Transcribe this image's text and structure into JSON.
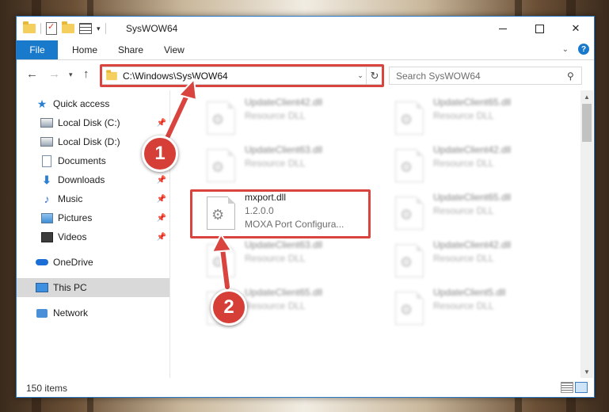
{
  "window": {
    "title": "SysWOW64",
    "accent_color": "#1979ca",
    "annotation_color": "#d9443f"
  },
  "ribbon": {
    "tabs": [
      {
        "label": "File"
      },
      {
        "label": "Home"
      },
      {
        "label": "Share"
      },
      {
        "label": "View"
      }
    ]
  },
  "nav": {
    "address": "C:\\Windows\\SysWOW64",
    "search_placeholder": "Search SysWOW64"
  },
  "sidebar": {
    "items": [
      {
        "label": "Quick access",
        "icon": "star-icon"
      },
      {
        "label": "Local Disk (C:)",
        "icon": "disk-icon"
      },
      {
        "label": "Local Disk (D:)",
        "icon": "disk-icon"
      },
      {
        "label": "Documents",
        "icon": "documents-icon"
      },
      {
        "label": "Downloads",
        "icon": "download-icon"
      },
      {
        "label": "Music",
        "icon": "music-icon"
      },
      {
        "label": "Pictures",
        "icon": "pictures-icon"
      },
      {
        "label": "Videos",
        "icon": "videos-icon"
      },
      {
        "label": "OneDrive",
        "icon": "cloud-icon"
      },
      {
        "label": "This PC",
        "icon": "computer-icon"
      },
      {
        "label": "Network",
        "icon": "network-icon"
      }
    ]
  },
  "files": {
    "left_column": [
      {
        "name": "UpdateClient42.dll",
        "type": "Resource DLL"
      },
      {
        "name": "UpdateClient63.dll",
        "type": "Resource DLL"
      },
      {
        "name": "mxport.dll",
        "version": "1.2.0.0",
        "description": "MOXA Port Configura..."
      },
      {
        "name": "UpdateClient63.dll",
        "type": "Resource DLL"
      },
      {
        "name": "UpdateClient65.dll",
        "type": "Resource DLL"
      }
    ],
    "right_column": [
      {
        "name": "UpdateClient65.dll",
        "type": "Resource DLL"
      },
      {
        "name": "UpdateClient42.dll",
        "type": "Resource DLL"
      },
      {
        "name": "UpdateClient65.dll",
        "type": "Resource DLL"
      },
      {
        "name": "UpdateClient42.dll",
        "type": "Resource DLL"
      },
      {
        "name": "UpdateClient5.dll",
        "type": "Resource DLL"
      }
    ]
  },
  "status": {
    "item_count": "150 items"
  },
  "annotations": {
    "step1": "1",
    "step2": "2"
  }
}
